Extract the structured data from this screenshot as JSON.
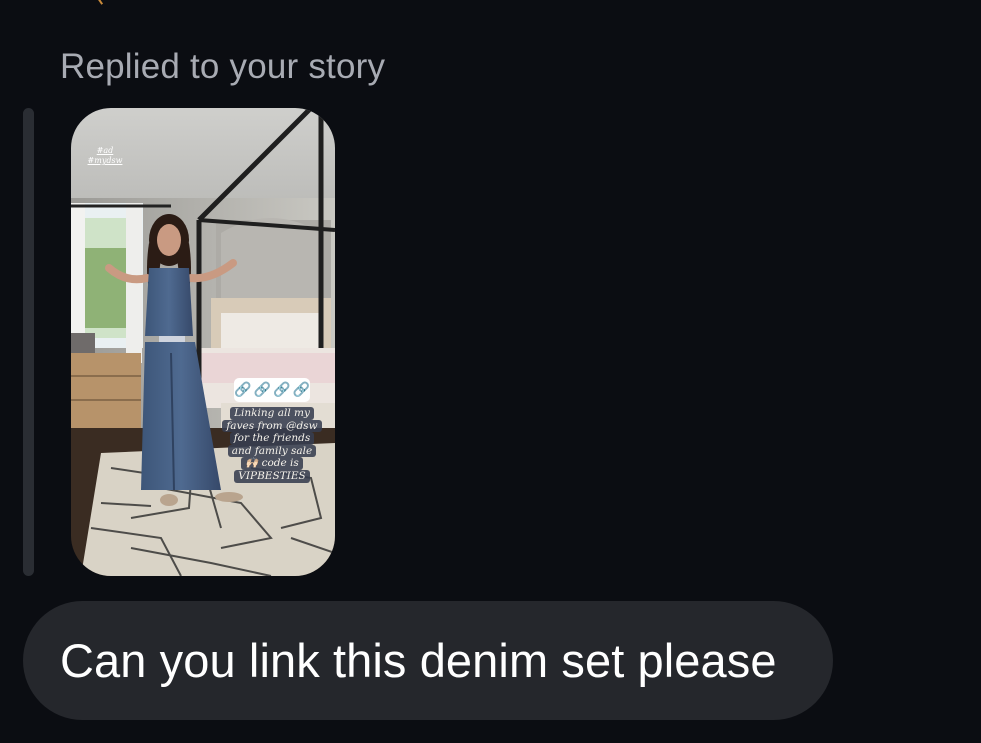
{
  "conversation": {
    "reply_label": "Replied to your story",
    "story": {
      "tags": [
        "#ad",
        "#mydsw"
      ],
      "link_sticker_icons": [
        "link-icon",
        "chain-icon",
        "chain-icon",
        "chain-icon"
      ],
      "caption_lines": [
        "Linking all my",
        "faves from @dsw",
        "for the friends",
        "and family sale",
        "🙌🏻 code is",
        "VIPBESTIES"
      ]
    },
    "message": {
      "text": "Can you link this denim set please"
    }
  },
  "colors": {
    "background": "#0b0d12",
    "bubble": "#25272c",
    "label": "#a8abb3",
    "text": "#ffffff"
  }
}
